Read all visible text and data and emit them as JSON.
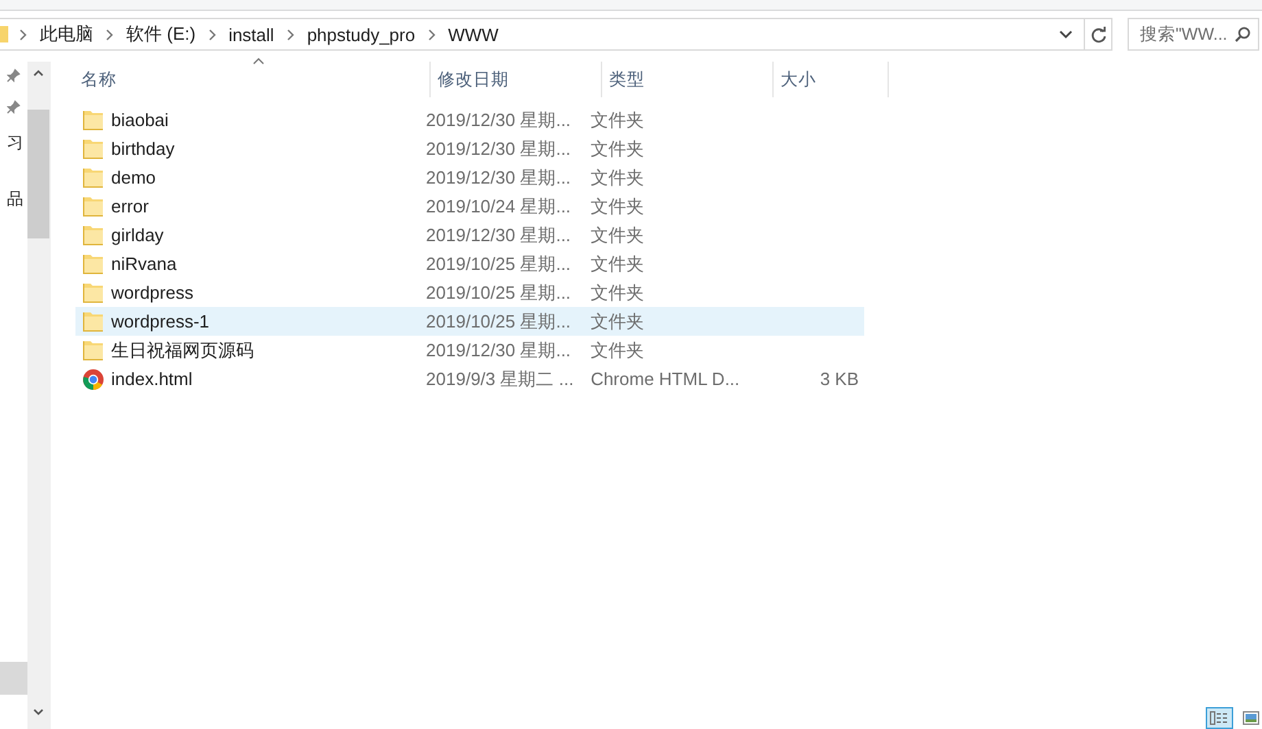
{
  "breadcrumbs": [
    "此电脑",
    "软件 (E:)",
    "install",
    "phpstudy_pro",
    "WWW"
  ],
  "search": {
    "placeholder": "搜索\"WW..."
  },
  "nav_pane": {
    "items": [
      {
        "label": "习"
      },
      {
        "label": "品"
      }
    ]
  },
  "columns": [
    {
      "label": "名称",
      "sorted": true
    },
    {
      "label": "修改日期",
      "sorted": false
    },
    {
      "label": "类型",
      "sorted": false
    },
    {
      "label": "大小",
      "sorted": false
    }
  ],
  "rows": [
    {
      "kind": "folder",
      "name": "biaobai",
      "date": "2019/12/30 星期...",
      "type": "文件夹",
      "selected": false
    },
    {
      "kind": "folder",
      "name": "birthday",
      "date": "2019/12/30 星期...",
      "type": "文件夹",
      "selected": false
    },
    {
      "kind": "folder",
      "name": "demo",
      "date": "2019/12/30 星期...",
      "type": "文件夹",
      "selected": false
    },
    {
      "kind": "folder",
      "name": "error",
      "date": "2019/10/24 星期...",
      "type": "文件夹",
      "selected": false
    },
    {
      "kind": "folder",
      "name": "girlday",
      "date": "2019/12/30 星期...",
      "type": "文件夹",
      "selected": false
    },
    {
      "kind": "folder",
      "name": "niRvana",
      "date": "2019/10/25 星期...",
      "type": "文件夹",
      "selected": false
    },
    {
      "kind": "folder",
      "name": "wordpress",
      "date": "2019/10/25 星期...",
      "type": "文件夹",
      "selected": false
    },
    {
      "kind": "folder",
      "name": "wordpress-1",
      "date": "2019/10/25 星期...",
      "type": "文件夹",
      "selected": true
    },
    {
      "kind": "folder",
      "name": "生日祝福网页源码",
      "date": "2019/12/30 星期...",
      "type": "文件夹",
      "selected": false
    },
    {
      "kind": "html",
      "name": "index.html",
      "date": "2019/9/3 星期二 ...",
      "type": "Chrome HTML D...",
      "size": "3 KB",
      "selected": false
    }
  ],
  "view_buttons": [
    {
      "kind": "details",
      "selected": true
    },
    {
      "kind": "large_icons",
      "selected": false
    }
  ]
}
